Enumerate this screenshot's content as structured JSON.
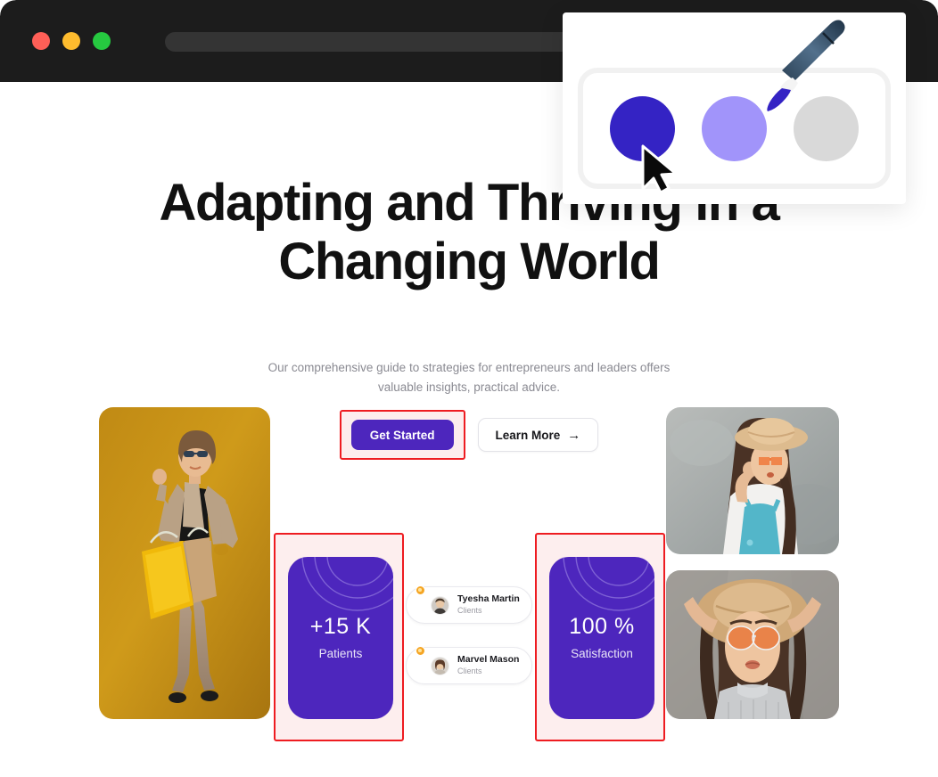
{
  "browser": {
    "traffic_lights": [
      {
        "name": "close",
        "color": "#ff5f57"
      },
      {
        "name": "minimize",
        "color": "#febc2e"
      },
      {
        "name": "zoom",
        "color": "#26c940"
      }
    ],
    "address_bar": {
      "value": "",
      "placeholder": ""
    }
  },
  "hero": {
    "title_line_1": "Adapting and Thriving in a",
    "title_line_2": "Changing World",
    "subtitle": "Our comprehensive guide to strategies for entrepreneurs and leaders offers valuable insights, practical advice."
  },
  "cta": {
    "primary_label": "Get Started",
    "secondary_label": "Learn More",
    "secondary_arrow": "→",
    "primary_color": "#4d26bd"
  },
  "stats": [
    {
      "value": "+15 K",
      "label": "Patients"
    },
    {
      "value": "100 %",
      "label": "Satisfaction"
    }
  ],
  "clients": [
    {
      "name": "Tyesha Martin",
      "role": "Clients"
    },
    {
      "name": "Marvel Mason",
      "role": "Clients"
    }
  ],
  "color_picker": {
    "swatches": [
      {
        "name": "indigo",
        "color": "#3423c4"
      },
      {
        "name": "light-purple",
        "color": "#a194fa"
      },
      {
        "name": "gray",
        "color": "#d9d9d9"
      }
    ]
  },
  "annotations": {
    "border_color": "#ee1c21",
    "fill_color": "#fdeeee"
  },
  "photos": [
    {
      "name": "woman-with-shopping-bags",
      "alt": "Woman in plaid suit holding yellow shopping bags on gold background"
    },
    {
      "name": "woman-in-hat-denim",
      "alt": "Woman with straw hat and orange sunglasses in denim overalls"
    },
    {
      "name": "woman-in-hat-lying-down",
      "alt": "Woman with straw hat and orange sunglasses lying down"
    }
  ]
}
